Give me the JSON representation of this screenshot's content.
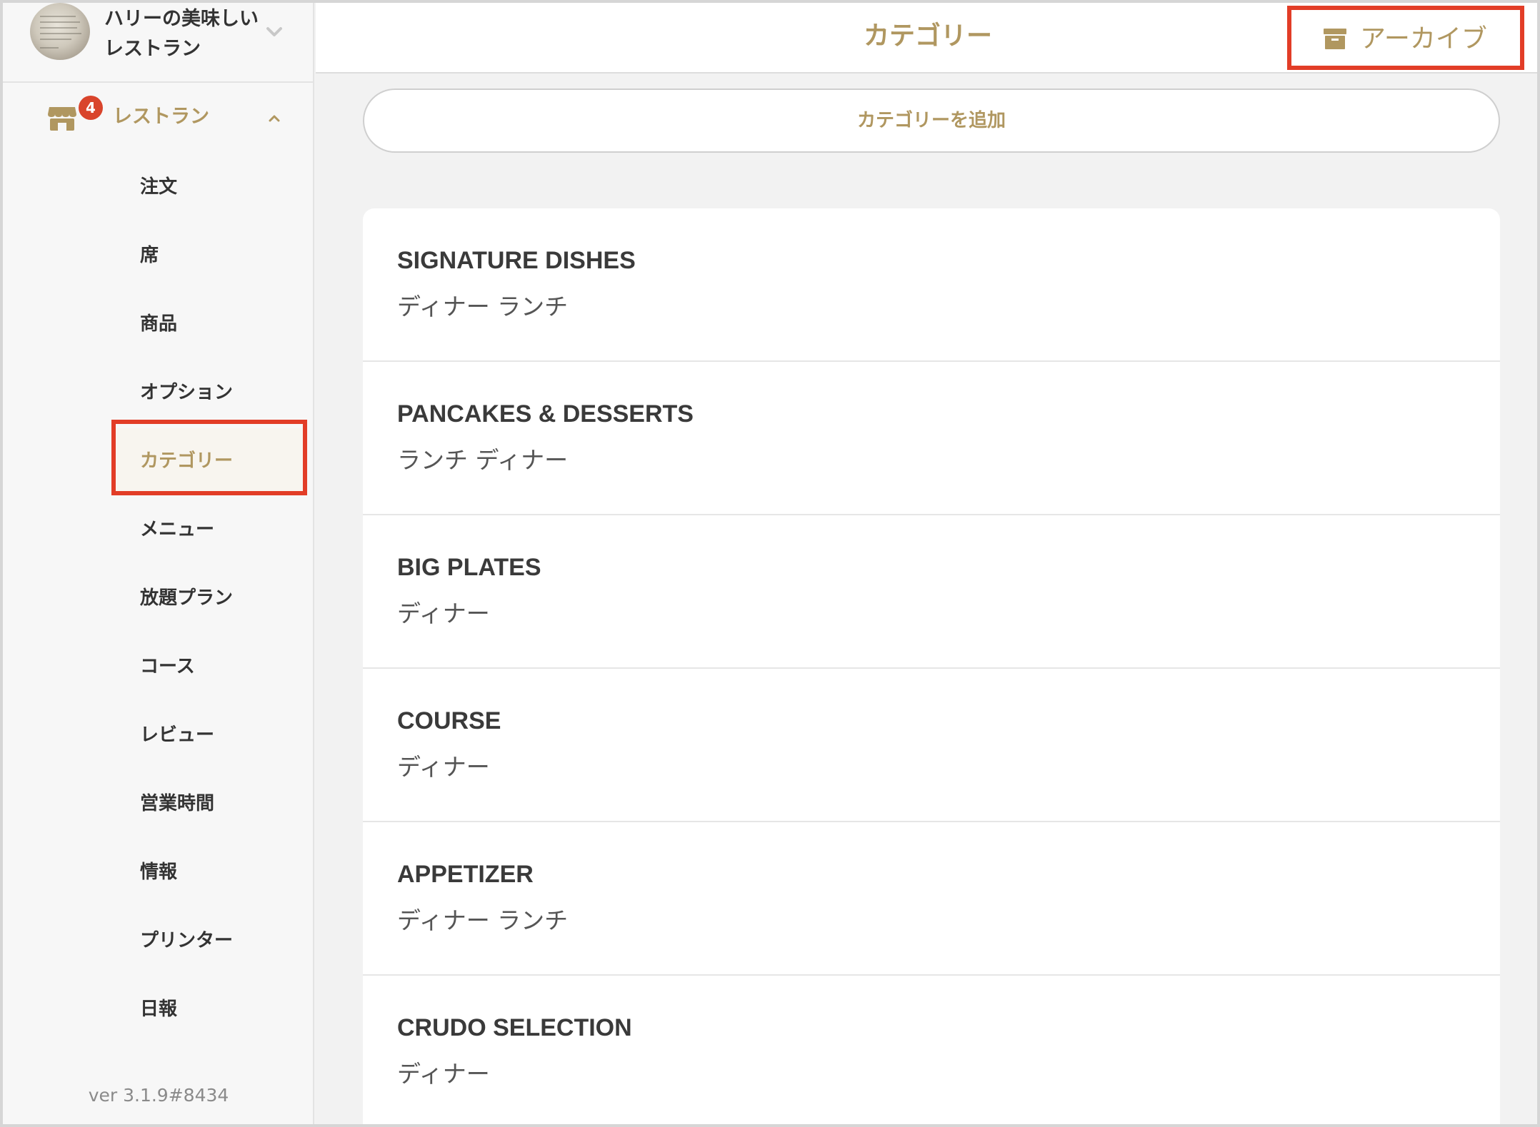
{
  "colors": {
    "accent": "#b09760",
    "badge": "#d9442b",
    "highlight": "#e23d27"
  },
  "store": {
    "name_line1": "ハリーの美味しい",
    "name_line2": "レストラン"
  },
  "section": {
    "label": "レストラン",
    "badge_count": "4"
  },
  "nav": {
    "items": [
      {
        "label": "注文"
      },
      {
        "label": "席"
      },
      {
        "label": "商品"
      },
      {
        "label": "オプション"
      },
      {
        "label": "カテゴリー",
        "active": true
      },
      {
        "label": "メニュー"
      },
      {
        "label": "放題プラン"
      },
      {
        "label": "コース"
      },
      {
        "label": "レビュー"
      },
      {
        "label": "営業時間"
      },
      {
        "label": "情報"
      },
      {
        "label": "プリンター"
      },
      {
        "label": "日報"
      }
    ]
  },
  "version": "ver 3.1.9#8434",
  "header": {
    "title": "カテゴリー",
    "archive_label": "アーカイブ"
  },
  "main": {
    "add_label": "カテゴリーを追加",
    "categories": [
      {
        "name": "SIGNATURE DISHES",
        "times": "ディナー ランチ"
      },
      {
        "name": "PANCAKES & DESSERTS",
        "times": "ランチ ディナー"
      },
      {
        "name": "BIG PLATES",
        "times": "ディナー"
      },
      {
        "name": "COURSE",
        "times": "ディナー"
      },
      {
        "name": "APPETIZER",
        "times": "ディナー ランチ"
      },
      {
        "name": "CRUDO SELECTION",
        "times": "ディナー"
      }
    ]
  }
}
